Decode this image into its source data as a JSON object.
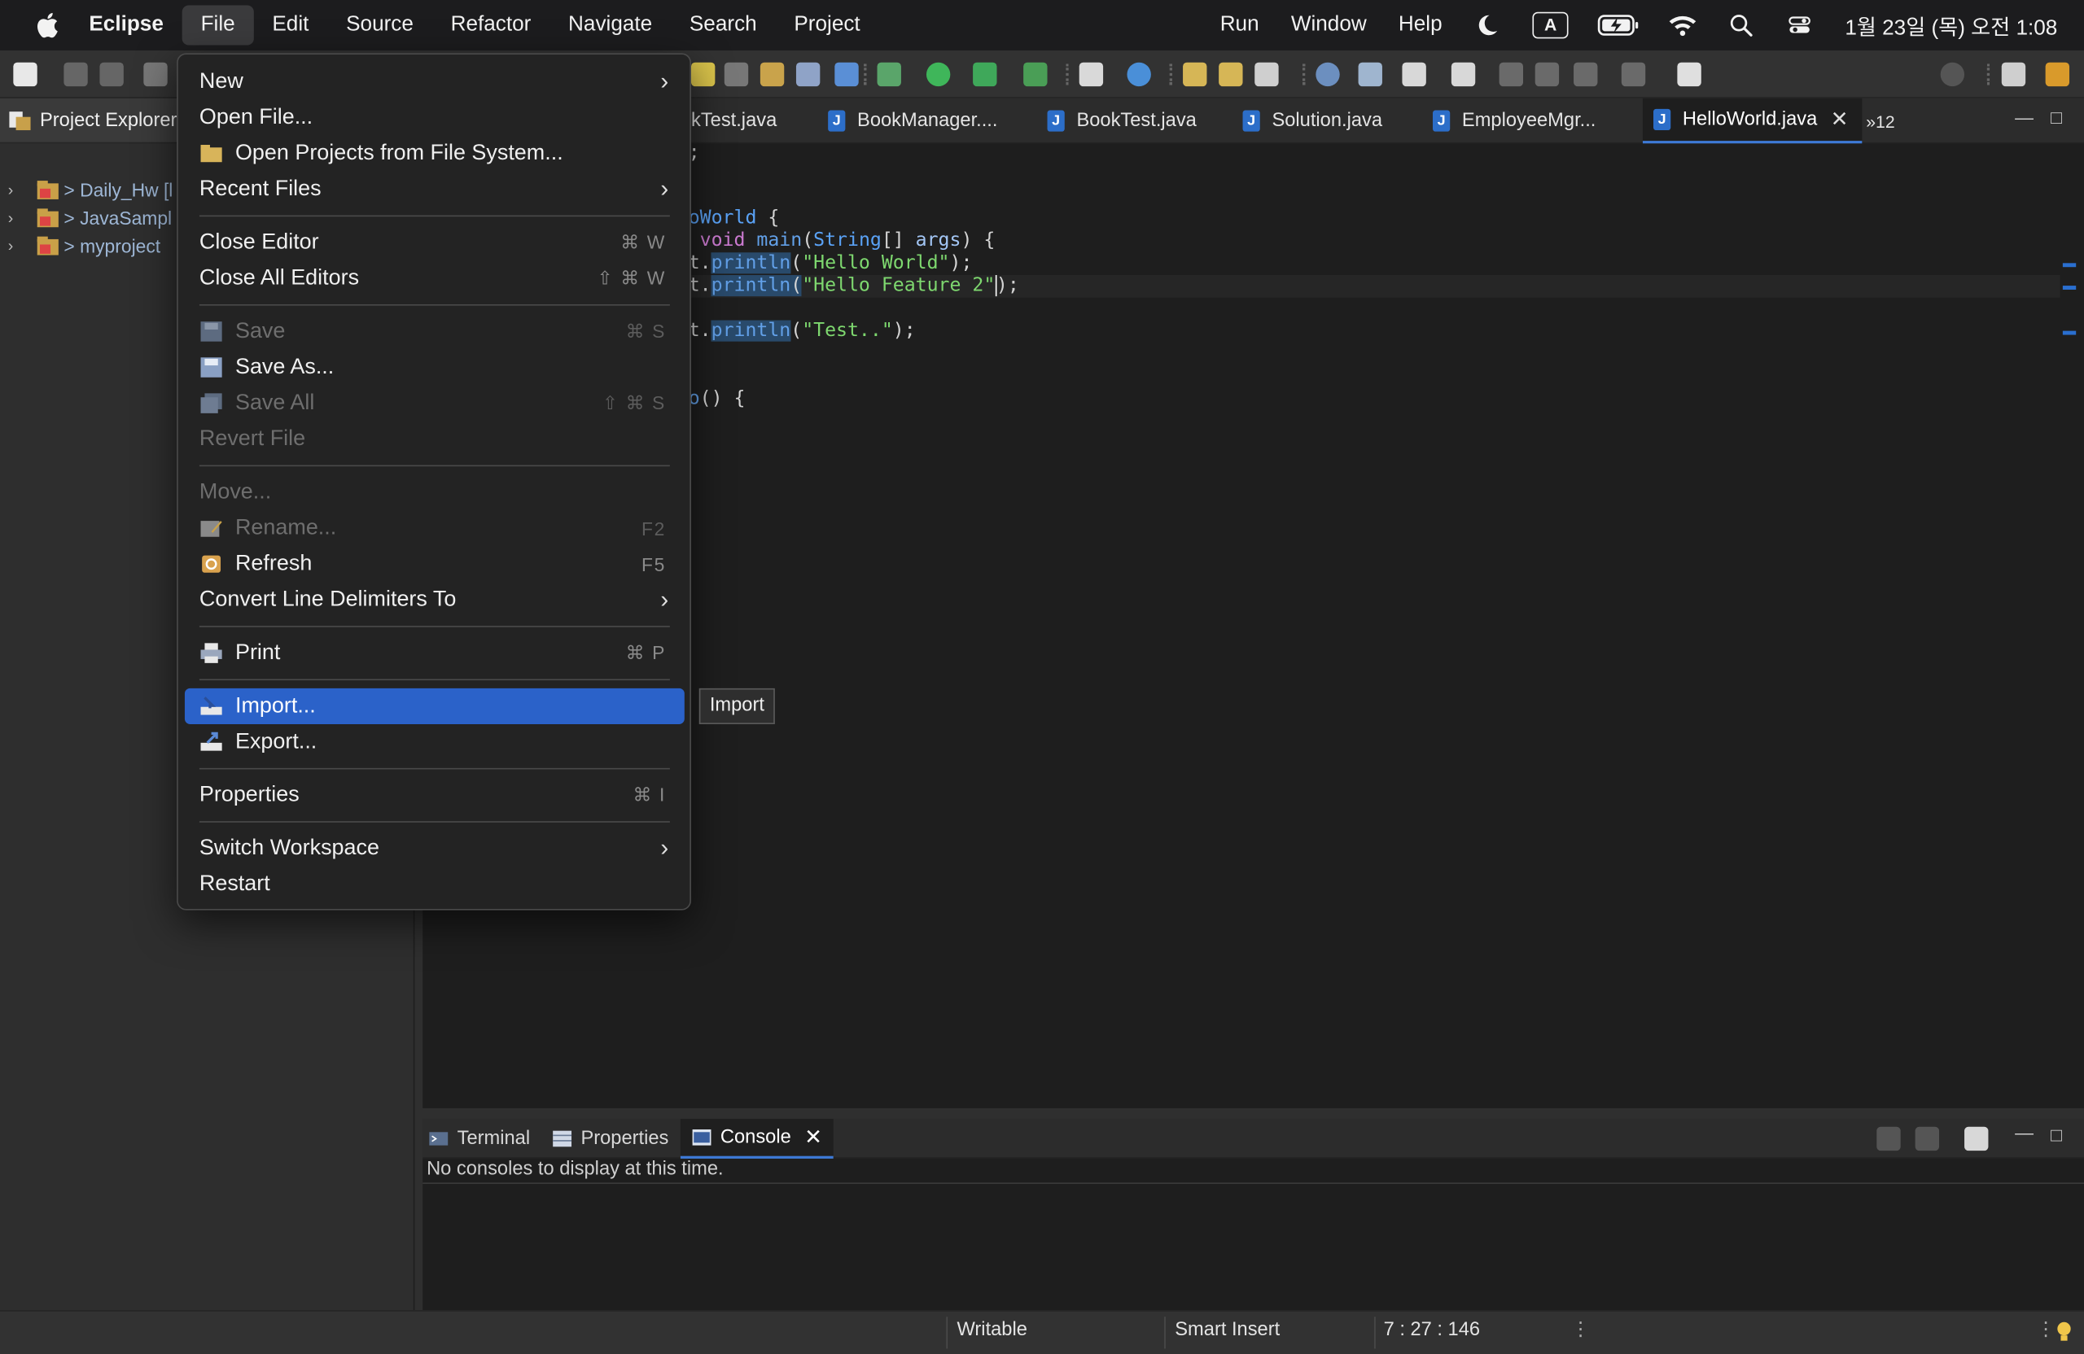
{
  "menubar": {
    "app": "Eclipse",
    "items": [
      "File",
      "Edit",
      "Source",
      "Refactor",
      "Navigate",
      "Search",
      "Project"
    ],
    "right_items": [
      "Run",
      "Window",
      "Help"
    ],
    "input_indicator": "A",
    "clock": "1월 23일 (목) 오전 1:08"
  },
  "explorer": {
    "title": "Project Explorer",
    "projects": [
      {
        "label": "> Daily_Hw [l"
      },
      {
        "label": "> JavaSampl"
      },
      {
        "label": "> myproject"
      }
    ]
  },
  "editor": {
    "tabs": [
      {
        "label": "kTest.java"
      },
      {
        "label": "BookManager...."
      },
      {
        "label": "BookTest.java"
      },
      {
        "label": "Solution.java"
      },
      {
        "label": "EmployeeMgr..."
      },
      {
        "label": "HelloWorld.java",
        "active": true
      }
    ],
    "overflow": "»12",
    "code": {
      "l1": ";",
      "l2_a": "oWorld",
      "l2_b": " {",
      "l3_kw": "void",
      "l3_fn": "main",
      "l3_type": "String",
      "l3_rest1": "[] ",
      "l3_arg": "args",
      "l3_rest2": ") {",
      "l4_a": "t.",
      "l4_fn": "println",
      "l4_s": "\"Hello World\"",
      "l4_end": ");",
      "l5_a": "t.",
      "l5_fn": "println",
      "l5_s": "\"Hello Feature 2\"",
      "l5_end": ");",
      "l6_a": "t.",
      "l6_fn": "println",
      "l6_s": "\"Test..\"",
      "l6_end": ");",
      "l7_a": "o",
      "l7_b": "() {"
    }
  },
  "file_menu": {
    "items": {
      "new": "New",
      "open_file": "Open File...",
      "open_projects": "Open Projects from File System...",
      "recent": "Recent Files",
      "close_editor": "Close Editor",
      "close_editor_sc": "⌘ W",
      "close_all": "Close All Editors",
      "close_all_sc": "⇧ ⌘ W",
      "save": "Save",
      "save_sc": "⌘ S",
      "save_as": "Save As...",
      "save_all": "Save All",
      "save_all_sc": "⇧ ⌘ S",
      "revert": "Revert File",
      "move": "Move...",
      "rename": "Rename...",
      "rename_sc": "F2",
      "refresh": "Refresh",
      "refresh_sc": "F5",
      "convert": "Convert Line Delimiters To",
      "print": "Print",
      "print_sc": "⌘ P",
      "import": "Import...",
      "export": "Export...",
      "properties": "Properties",
      "properties_sc": "⌘ I",
      "switch_ws": "Switch Workspace",
      "restart": "Restart"
    },
    "tooltip": "Import"
  },
  "bottom_panel": {
    "tabs": [
      "Terminal",
      "Properties",
      "Console"
    ],
    "message": "No consoles to display at this time."
  },
  "statusbar": {
    "writable": "Writable",
    "insert_mode": "Smart Insert",
    "position": "7 : 27 : 146"
  },
  "colors": {
    "selection": "#2b62c9",
    "accent": "#3e7ad7"
  }
}
